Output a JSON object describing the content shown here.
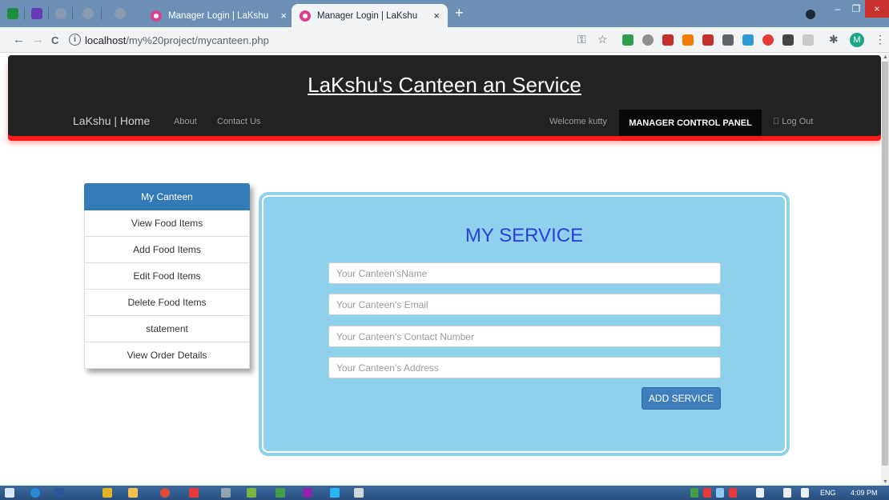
{
  "browser": {
    "tabs": [
      {
        "title": "Manager Login | LaKshu",
        "close": "×"
      },
      {
        "title": "Manager Login | LaKshu",
        "close": "×"
      }
    ],
    "new_tab": "+",
    "url_host": "localhost",
    "url_path": "/my%20project/mycanteen.php",
    "profile_initial": "M",
    "back_glyph": "←",
    "forward_glyph": "→",
    "reload_glyph": "C",
    "info_glyph": "i",
    "key_glyph": "⚿",
    "star_glyph": "☆",
    "puzzle_glyph": "✱",
    "menu_glyph": "⋮",
    "minimize": "–",
    "maximize": "❐",
    "close": "×"
  },
  "nav": {
    "site_title": "LaKshu's Canteen an Service",
    "brand": "LaKshu | Home",
    "about": "About",
    "contact": "Contact Us",
    "welcome": "Welcome kutty",
    "manager_panel": "MANAGER CONTROL PANEL",
    "logout": " Log Out"
  },
  "sidebar": {
    "items": [
      {
        "label": "My Canteen"
      },
      {
        "label": "View Food Items"
      },
      {
        "label": "Add Food Items"
      },
      {
        "label": "Edit Food Items"
      },
      {
        "label": "Delete Food Items"
      },
      {
        "label": "statement"
      },
      {
        "label": "View Order Details"
      }
    ]
  },
  "service": {
    "title": "MY SERVICE",
    "name_placeholder": "Your Canteen'sName",
    "email_placeholder": "Your Canteen's Email",
    "contact_placeholder": "Your Canteen's Contact Number",
    "address_placeholder": "Your Canteen's Address",
    "submit_label": "ADD SERVICE"
  },
  "taskbar": {
    "language": "ENG",
    "time": "4:09 PM"
  },
  "colors": {
    "navbar": "#222222",
    "navbar_accent": "#ff1a1a",
    "sidebar_active": "#337ab7",
    "service_bg": "#8fd0ec",
    "service_title": "#2a3fe0",
    "button": "#3f7fbd"
  }
}
